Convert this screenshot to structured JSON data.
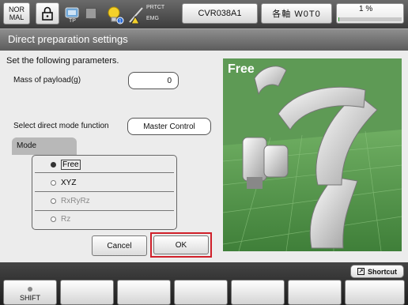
{
  "status_bar": {
    "mode_label_line1": "NOR",
    "mode_label_line2": "MAL",
    "tp_label": "TP",
    "prtct_label": "PRTCT",
    "emg_label": "EMG",
    "robot_name": "CVR038A1",
    "axis_mode": "各軸 W0T0",
    "speed_text": "1 %",
    "speed_fraction": 0.01
  },
  "title": "Direct preparation settings",
  "form": {
    "instruction": "Set the following parameters.",
    "mass_label": "Mass of payload(g)",
    "mass_value": "0",
    "function_label": "Select direct mode function",
    "function_value": "Master Control",
    "mode_tab_label": "Mode",
    "modes": [
      {
        "label": "Free",
        "selected": true,
        "enabled": true
      },
      {
        "label": "XYZ",
        "selected": false,
        "enabled": true
      },
      {
        "label": "RxRyRz",
        "selected": false,
        "enabled": false
      },
      {
        "label": "Rz",
        "selected": false,
        "enabled": false
      }
    ],
    "cancel_label": "Cancel",
    "ok_label": "OK",
    "highlight_color": "#d0202a"
  },
  "robot_image": {
    "caption": "Free"
  },
  "bottom": {
    "shortcut_label": "Shortcut",
    "shift_label": "SHIFT"
  }
}
